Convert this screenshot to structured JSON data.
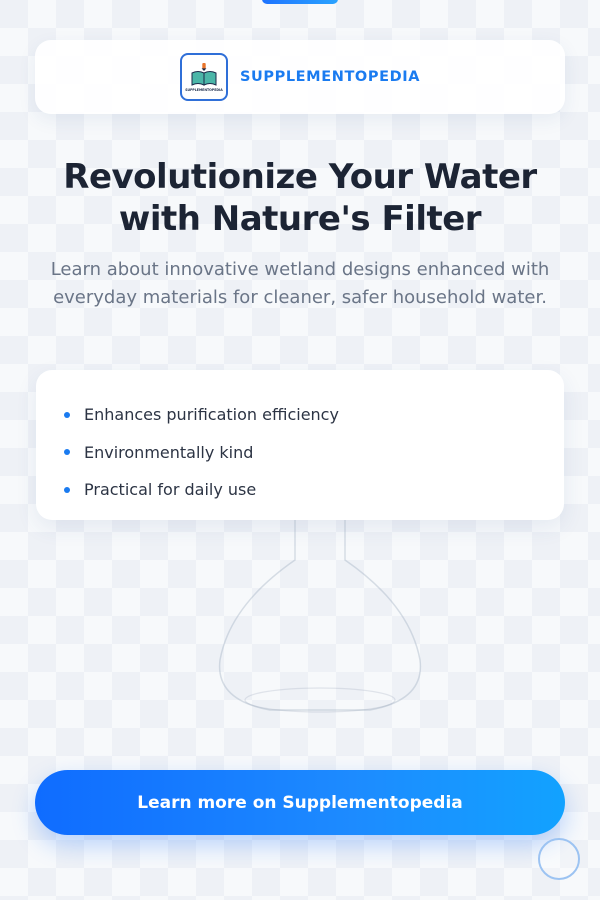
{
  "header": {
    "brand_name": "SUPPLEMENTOPEDIA",
    "logo_text": "SUPPLEMENTOPEDIA",
    "logo_icon": "open-book-icon"
  },
  "hero": {
    "headline": "Revolutionize Your Water with Nature's Filter",
    "subtitle": "Learn about innovative wetland designs enhanced with everyday materials for cleaner, safer household water."
  },
  "benefits": [
    "Enhances purification efficiency",
    "Environmentally kind",
    "Practical for daily use"
  ],
  "cta": {
    "label": "Learn more on Supplementopedia"
  },
  "colors": {
    "accent": "#1a7bf0",
    "cta_gradient_start": "#0f6cff",
    "cta_gradient_end": "#12a2ff",
    "headline": "#1c2434",
    "subtitle": "#6a7587"
  },
  "icons": {
    "background_decoration": "flask-icon",
    "scroll_button": "circle-icon"
  }
}
